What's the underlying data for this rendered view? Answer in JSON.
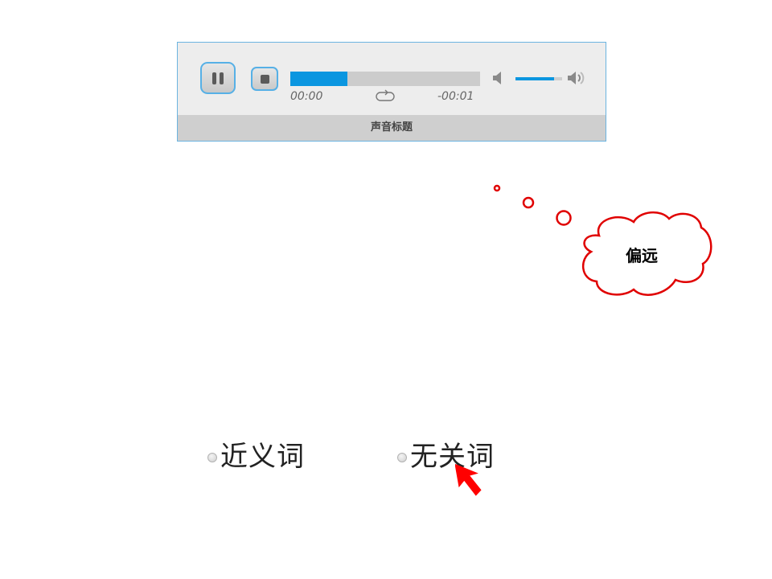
{
  "player": {
    "title": "声音标题",
    "current_time": "00:00",
    "remaining_time": "-00:01",
    "progress_fraction": 0.3,
    "volume_fraction": 0.82,
    "buttons": {
      "pause_icon": "pause-icon",
      "stop_icon": "stop-icon",
      "loop_icon": "loop-icon",
      "volume_low_icon": "volume-low-icon",
      "volume_high_icon": "volume-high-icon"
    }
  },
  "thought_bubble": {
    "text": "偏远",
    "color": "#e00000"
  },
  "options": [
    {
      "label": "近义词"
    },
    {
      "label": "无关词"
    }
  ],
  "colors": {
    "accent": "#0b96e0",
    "border": "#56b0e6",
    "cursor": "#ff0000"
  }
}
